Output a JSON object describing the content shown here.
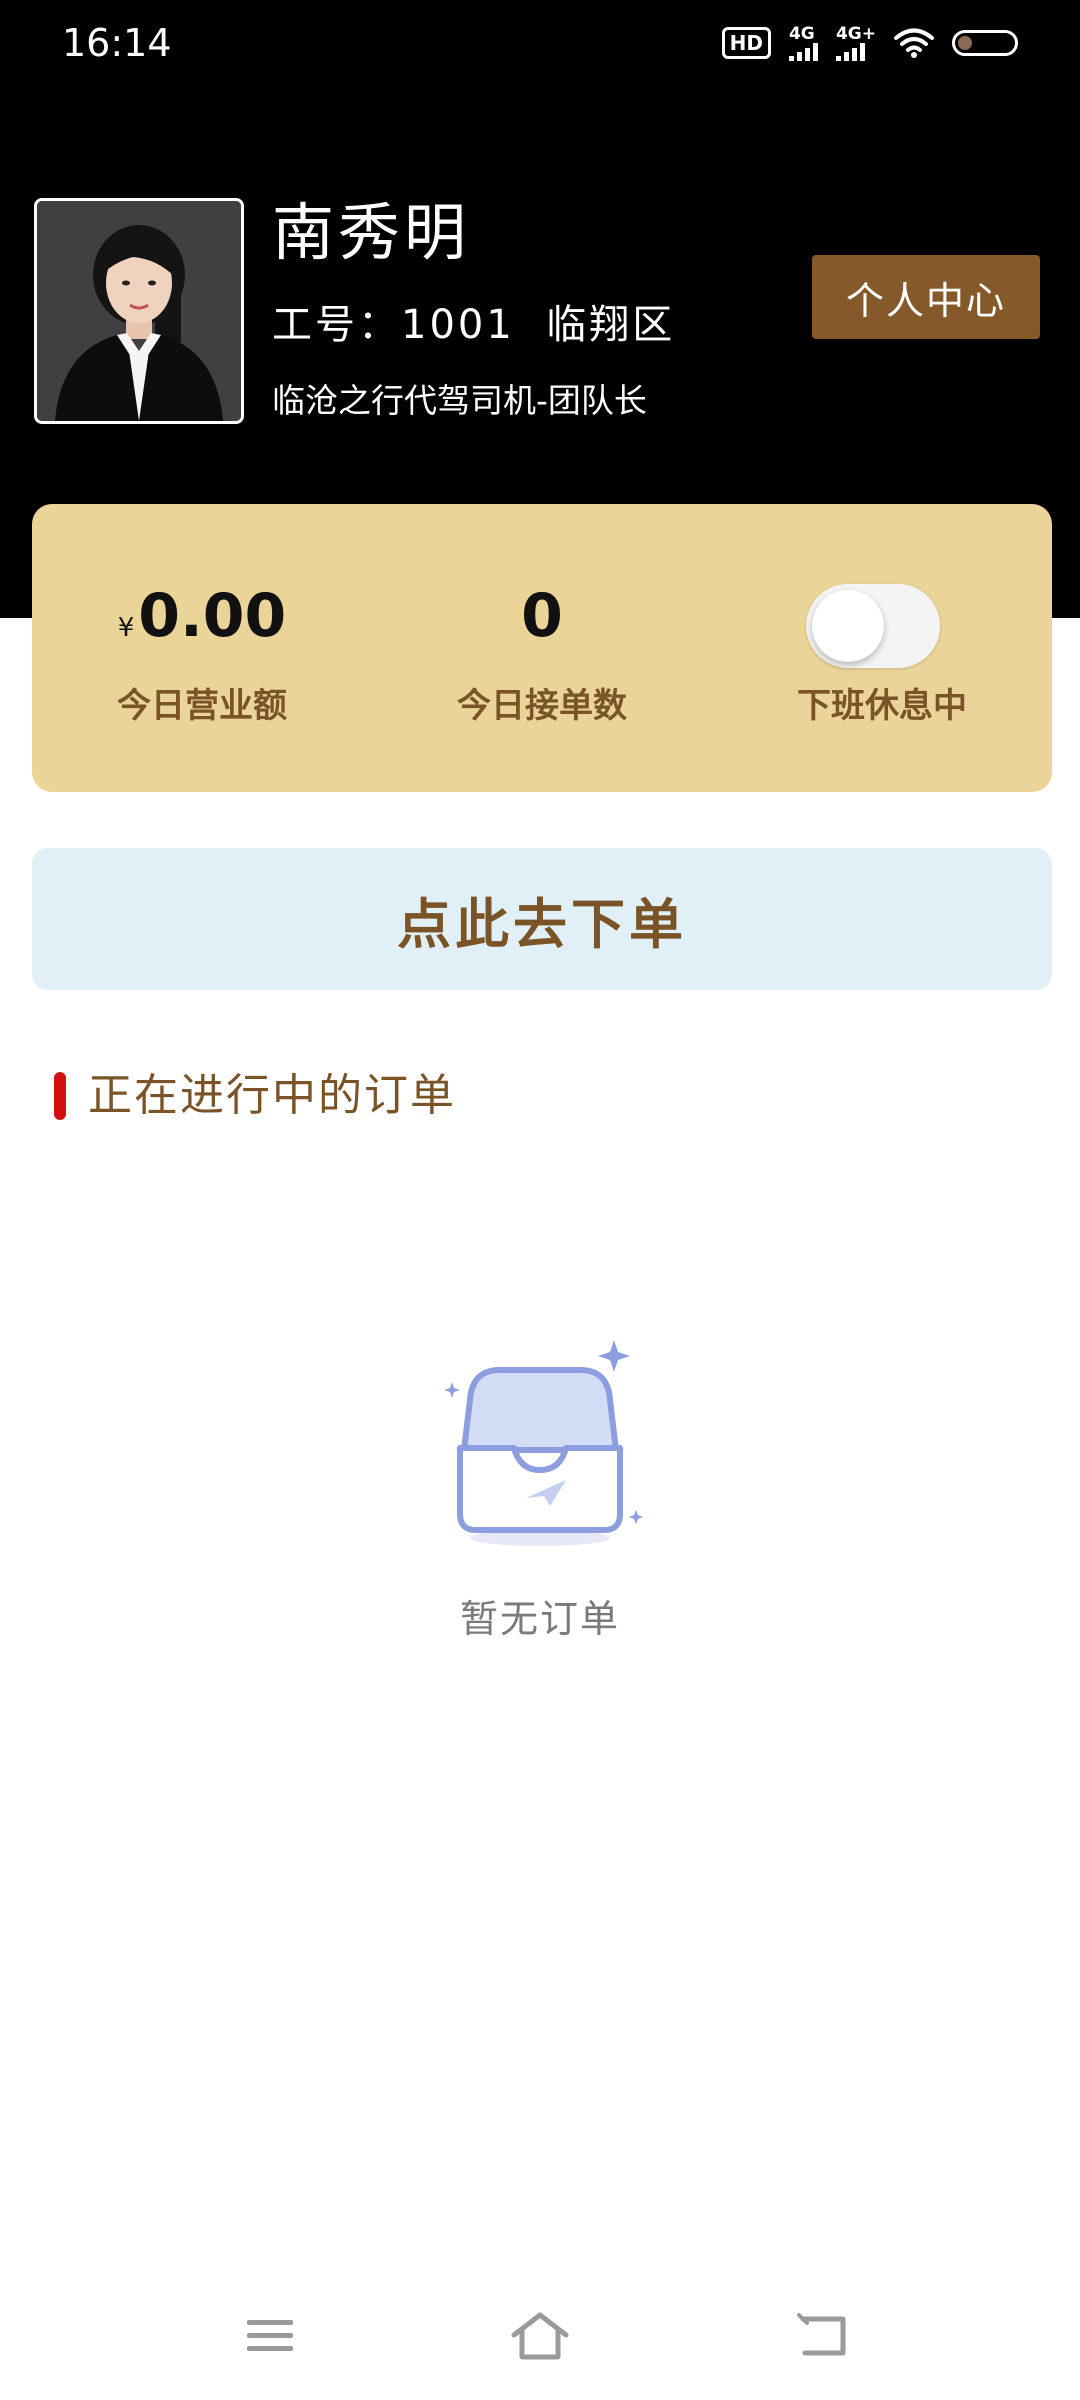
{
  "status_bar": {
    "time": "16:14",
    "hd_label": "HD",
    "signal1_label": "4G",
    "signal2_label": "4G+",
    "icons": [
      "hd-voice-icon",
      "signal-4g-icon",
      "signal-4g-plus-icon",
      "wifi-icon",
      "battery-icon"
    ]
  },
  "profile": {
    "name": "南秀明",
    "id_line": "工号：1001  临翔区",
    "title": "临沧之行代驾司机-团队长",
    "center_button": "个人中心"
  },
  "stats": {
    "currency_symbol": "¥",
    "revenue_value": "0.00",
    "revenue_label": "今日营业额",
    "orders_value": "0",
    "orders_label": "今日接单数",
    "status_label": "下班休息中",
    "on_duty": false
  },
  "order_button": "点此去下单",
  "section": {
    "title": "正在进行中的订单"
  },
  "empty_state": {
    "icon": "empty-inbox-icon",
    "text": "暂无订单"
  },
  "nav_bar": {
    "icons": [
      "menu-icon",
      "home-icon",
      "back-icon"
    ]
  },
  "colors": {
    "header_bg": "#000000",
    "card_bg": "#ebd497",
    "brand_brown": "#85592a",
    "label_brown": "#7a5326",
    "order_button_bg": "#e1f0f6",
    "section_accent": "#d40f0f"
  }
}
